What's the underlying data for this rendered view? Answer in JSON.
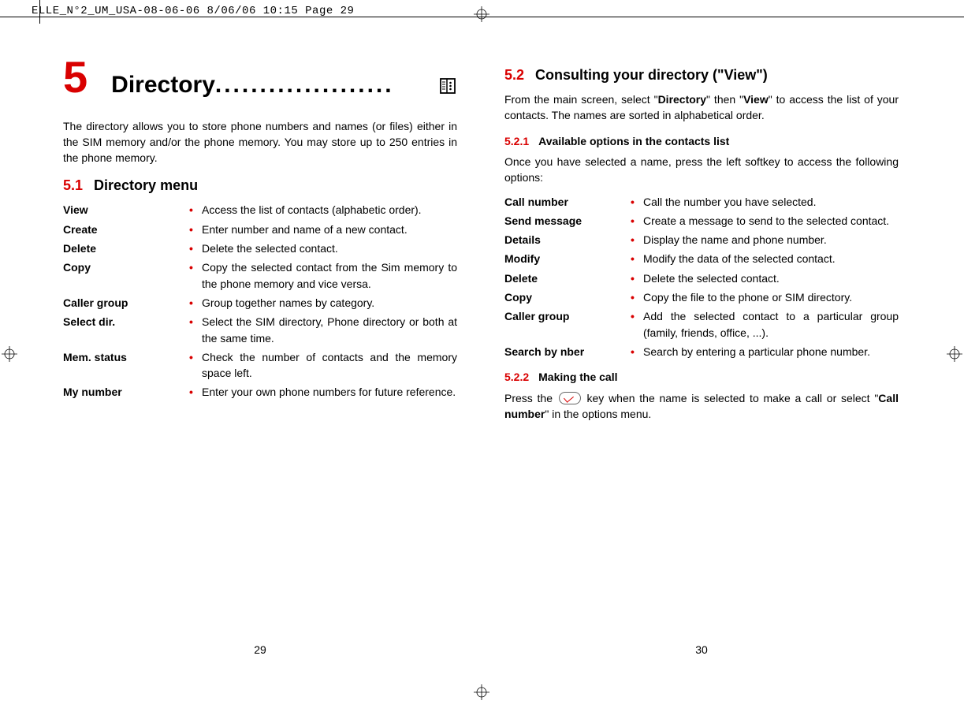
{
  "print_header": "ELLE_N°2_UM_USA-08-06-06  8/06/06  10:15  Page 29",
  "chapter": {
    "number": "5",
    "title": "Directory"
  },
  "intro": "The directory allows you to store phone numbers and names (or files) either in the SIM memory and/or the phone memory. You may store up to 250 entries in the phone memory.",
  "sec51": {
    "num": "5.1",
    "title": "Directory menu",
    "items": [
      {
        "term": "View",
        "desc": "Access the list of contacts (alphabetic order)."
      },
      {
        "term": "Create",
        "desc": "Enter number and name of a new contact."
      },
      {
        "term": "Delete",
        "desc": "Delete the selected contact."
      },
      {
        "term": "Copy",
        "desc": "Copy the selected contact from the Sim memory to the phone memory and vice versa."
      },
      {
        "term": "Caller group",
        "desc": "Group together names by category."
      },
      {
        "term": "Select dir.",
        "desc": "Select the SIM directory, Phone directory or both at the same time."
      },
      {
        "term": "Mem. status",
        "desc": "Check the number of contacts and the memory space left."
      },
      {
        "term": "My number",
        "desc": "Enter your own phone numbers for future reference."
      }
    ]
  },
  "sec52": {
    "num": "5.2",
    "title": "Consulting your directory (\"View\")",
    "intro_pre": "From the main screen, select \"",
    "intro_b1": "Directory",
    "intro_mid": "\" then \"",
    "intro_b2": "View",
    "intro_post": "\" to access the list of your contacts. The names are sorted in alphabetical order.",
    "sub521": {
      "num": "5.2.1",
      "title": "Available options in the contacts list",
      "intro": "Once you have selected a name, press the left softkey to access the following options:",
      "items": [
        {
          "term": "Call number",
          "desc": "Call the number you have selected."
        },
        {
          "term": "Send message",
          "desc": "Create a message to send to the selected contact."
        },
        {
          "term": "Details",
          "desc": "Display the name and phone number."
        },
        {
          "term": "Modify",
          "desc": "Modify the data of the selected contact."
        },
        {
          "term": "Delete",
          "desc": "Delete the selected contact."
        },
        {
          "term": "Copy",
          "desc": "Copy the file to the phone or SIM directory."
        },
        {
          "term": "Caller group",
          "desc": "Add the selected contact to a particular group (family, friends, office, ...)."
        },
        {
          "term": "Search by nber",
          "desc": "Search by entering a particular phone number."
        }
      ]
    },
    "sub522": {
      "num": "5.2.2",
      "title": "Making the call",
      "text_pre": "Press the ",
      "text_mid": " key when the name is selected to make a call or select \"",
      "text_b": "Call number",
      "text_post": "\" in the options menu."
    }
  },
  "page_numbers": {
    "left": "29",
    "right": "30"
  }
}
